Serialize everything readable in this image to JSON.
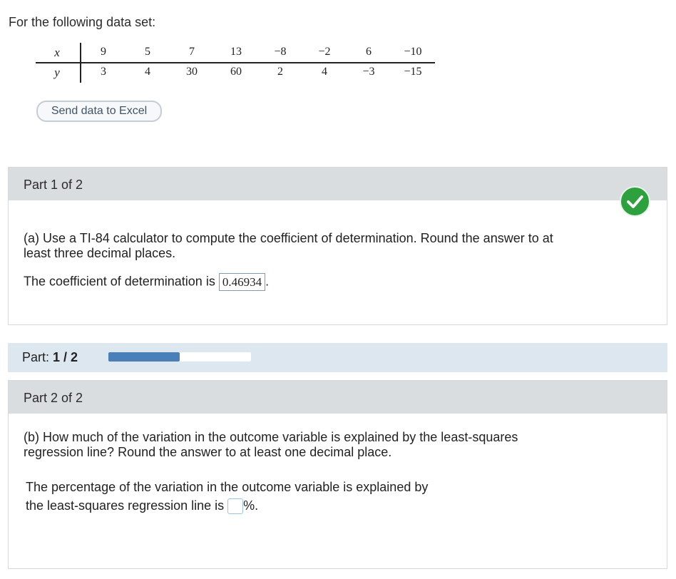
{
  "intro": "For the following data set:",
  "table": {
    "x_label": "x",
    "y_label": "y",
    "x_values": [
      "9",
      "5",
      "7",
      "13",
      "−8",
      "−2",
      "6",
      "−10"
    ],
    "y_values": [
      "3",
      "4",
      "30",
      "60",
      "2",
      "4",
      "−3",
      "−15"
    ]
  },
  "send_button": "Send data to Excel",
  "part1": {
    "header": "Part 1 of 2",
    "question_line1": "(a) Use a TI-84 calculator to compute the coefficient of determination. Round the answer to at",
    "question_line2": "least three decimal places.",
    "answer_prefix": "The coefficient of determination is",
    "answer_value": "0.46934",
    "answer_suffix": "."
  },
  "progress": {
    "label_prefix": "Part:",
    "label_value": "1 / 2",
    "fraction": 0.5
  },
  "part2": {
    "header": "Part 2 of 2",
    "question_line1": "(b) How much of the variation in the outcome variable is explained by the least-squares",
    "question_line2": "regression line? Round the answer to at least one decimal place.",
    "answer_line1": "The percentage of the variation in the outcome variable is explained by",
    "answer_line2_prefix": "the least-squares regression line is",
    "answer_suffix": "%."
  },
  "colors": {
    "check": "#2ea13f",
    "progress_fill": "#4a7fb8",
    "progress_band": "#dde7f0",
    "panel_header": "#d9dde0"
  },
  "icons": {
    "check": "checkmark-icon"
  }
}
